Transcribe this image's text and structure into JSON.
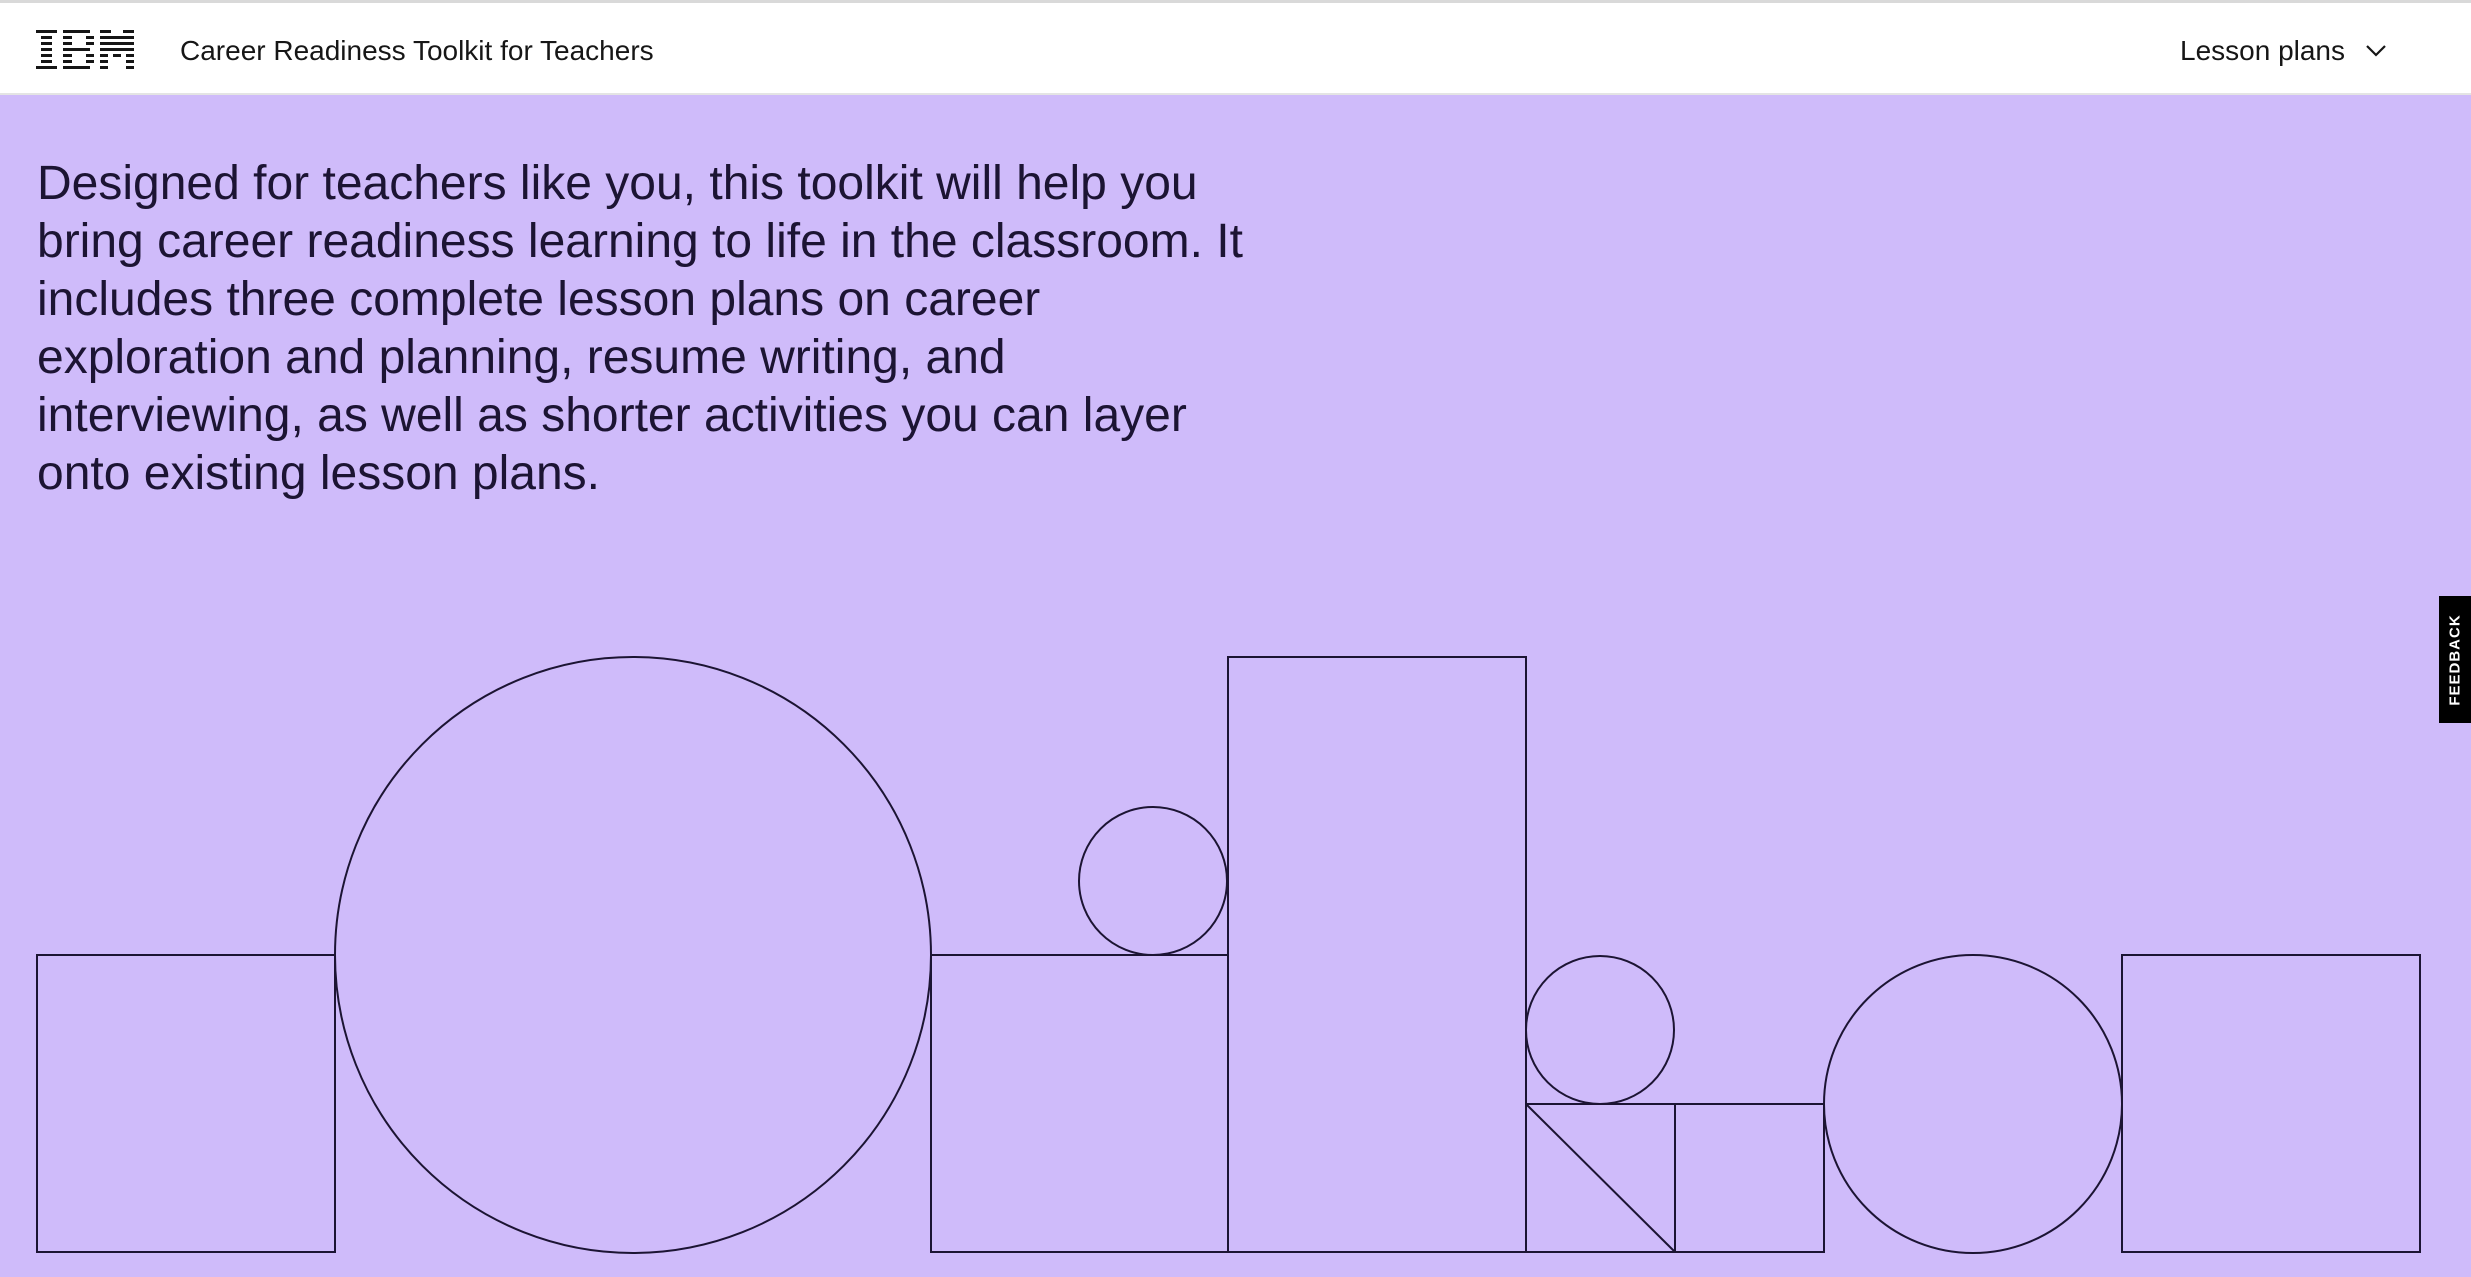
{
  "header": {
    "logo_text": "IBM",
    "site_title": "Career Readiness Toolkit for Teachers",
    "nav_dropdown_label": "Lesson plans"
  },
  "main": {
    "intro_text": "Designed for teachers like you, this toolkit will help you bring career readiness learning to life in the classroom. It includes three complete lesson plans on career exploration and planning, resume writing, and interviewing, as well as shorter activities you can layer onto existing lesson plans."
  },
  "feedback": {
    "label": "FEEDBACK"
  },
  "colors": {
    "background": "#cfbbfa",
    "line": "#1c1433",
    "header_bg": "#ffffff",
    "feedback_bg": "#000000"
  },
  "icons": {
    "logo": "ibm-logo",
    "dropdown": "chevron-down-icon"
  }
}
